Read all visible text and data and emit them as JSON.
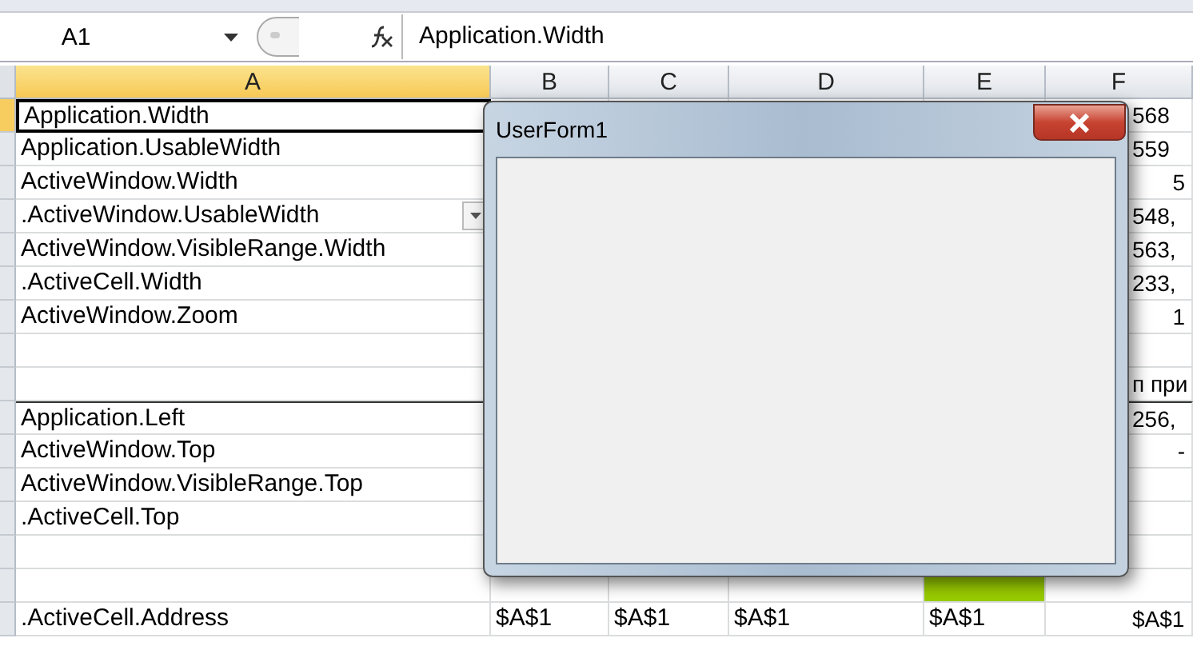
{
  "formula_bar": {
    "name_box": "A1",
    "formula": "Application.Width"
  },
  "columns": [
    {
      "label": "A",
      "selected": true
    },
    {
      "label": "B",
      "selected": false
    },
    {
      "label": "C",
      "selected": false
    },
    {
      "label": "D",
      "selected": false
    },
    {
      "label": "E",
      "selected": false
    },
    {
      "label": "F",
      "selected": false
    }
  ],
  "rows": [
    {
      "selected": true,
      "dropdown": false,
      "cells": [
        {
          "text": "Application.Width"
        },
        {},
        {},
        {},
        {},
        {
          "text": "568",
          "kind": "left"
        }
      ]
    },
    {
      "selected": false,
      "dropdown": false,
      "cells": [
        {
          "text": "Application.UsableWidth"
        },
        {},
        {},
        {},
        {},
        {
          "text": "559",
          "kind": "left"
        }
      ]
    },
    {
      "selected": false,
      "dropdown": false,
      "cells": [
        {
          "text": "ActiveWindow.Width"
        },
        {},
        {},
        {},
        {},
        {
          "text": "5",
          "kind": "right"
        }
      ]
    },
    {
      "selected": false,
      "dropdown": true,
      "cells": [
        {
          "text": ".ActiveWindow.UsableWidth"
        },
        {},
        {},
        {},
        {},
        {
          "text": "548,",
          "kind": "left"
        }
      ]
    },
    {
      "selected": false,
      "dropdown": false,
      "cells": [
        {
          "text": "ActiveWindow.VisibleRange.Width"
        },
        {},
        {},
        {},
        {},
        {
          "text": "563,",
          "kind": "left"
        }
      ]
    },
    {
      "selected": false,
      "dropdown": false,
      "cells": [
        {
          "text": ".ActiveCell.Width"
        },
        {},
        {},
        {},
        {},
        {
          "text": "233,",
          "kind": "left"
        }
      ]
    },
    {
      "selected": false,
      "dropdown": false,
      "cells": [
        {
          "text": "ActiveWindow.Zoom"
        },
        {},
        {},
        {},
        {},
        {
          "text": "1",
          "kind": "right"
        }
      ]
    },
    {
      "selected": false,
      "dropdown": false,
      "cells": [
        {},
        {},
        {},
        {},
        {},
        {}
      ]
    },
    {
      "selected": false,
      "dropdown": false,
      "cells": [
        {},
        {},
        {},
        {},
        {},
        {
          "text": "п при",
          "kind": "left"
        }
      ]
    },
    {
      "selected": false,
      "dropdown": false,
      "cells": [
        {
          "text": "Application.Left"
        },
        {},
        {},
        {},
        {},
        {
          "text": "256,",
          "kind": "left"
        }
      ]
    },
    {
      "selected": false,
      "dropdown": false,
      "cells": [
        {
          "text": "ActiveWindow.Top"
        },
        {},
        {},
        {},
        {},
        {
          "text": "-",
          "kind": "right"
        }
      ]
    },
    {
      "selected": false,
      "dropdown": false,
      "cells": [
        {
          "text": "ActiveWindow.VisibleRange.Top"
        },
        {},
        {},
        {},
        {},
        {}
      ]
    },
    {
      "selected": false,
      "dropdown": false,
      "cells": [
        {
          "text": ".ActiveCell.Top"
        },
        {},
        {},
        {},
        {},
        {}
      ]
    },
    {
      "selected": false,
      "dropdown": false,
      "cells": [
        {},
        {},
        {},
        {},
        {},
        {}
      ]
    },
    {
      "selected": false,
      "dropdown": false,
      "cells": [
        {},
        {},
        {},
        {},
        {
          "color": "#99cc00"
        },
        {}
      ]
    },
    {
      "selected": false,
      "dropdown": false,
      "cells": [
        {
          "text": ".ActiveCell.Address"
        },
        {
          "text": "$A$1",
          "kind": "left"
        },
        {
          "text": "$A$1",
          "kind": "left"
        },
        {
          "text": "$A$1",
          "kind": "left"
        },
        {
          "text": "$A$1",
          "kind": "left"
        },
        {
          "text": "$A$1",
          "kind": "left"
        }
      ]
    }
  ],
  "dialog": {
    "title": "UserForm1"
  }
}
